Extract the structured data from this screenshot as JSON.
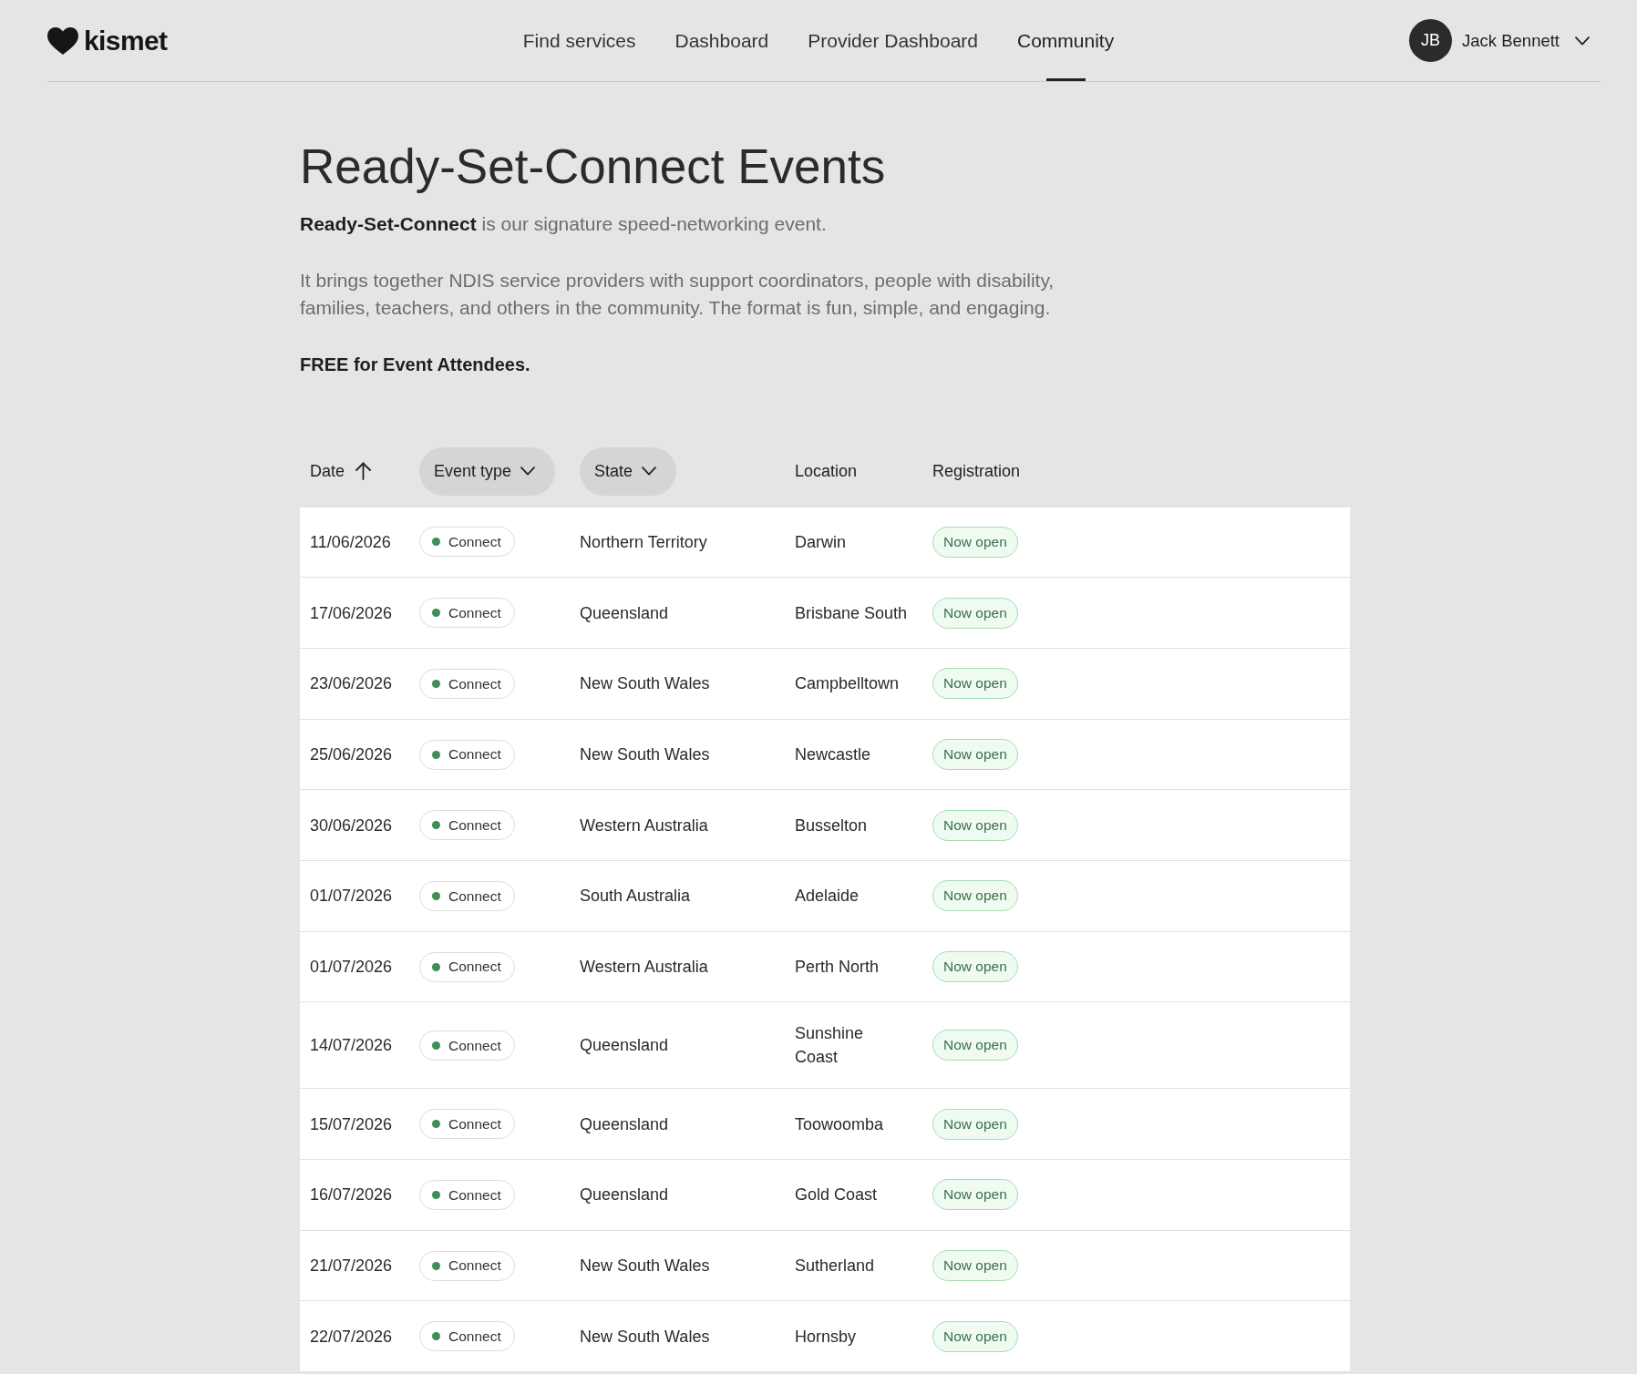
{
  "header": {
    "logo": "kismet",
    "nav": [
      {
        "label": "Find services",
        "selected": false
      },
      {
        "label": "Dashboard",
        "selected": false
      },
      {
        "label": "Provider Dashboard",
        "selected": false
      },
      {
        "label": "Community",
        "selected": true
      }
    ],
    "user": {
      "initials": "JB",
      "name": "Jack Bennett"
    }
  },
  "intro": {
    "title": "Ready-Set-Connect Events",
    "tagline": "**Ready-Set-Connect** is our signature speed-networking event.",
    "description": "It brings together NDIS service providers with support coordinators, people with disability, families, teachers, and others in the community. The format is fun, simple, and engaging.",
    "note": "FREE for Event Attendees."
  },
  "table": {
    "columns": [
      {
        "label": "Date",
        "kind": "sort",
        "ascending": true
      },
      {
        "label": "Event type",
        "kind": "filter"
      },
      {
        "label": "State",
        "kind": "filter"
      },
      {
        "label": "Location",
        "kind": "text"
      },
      {
        "label": "Registration",
        "kind": "text"
      }
    ],
    "rows": [
      {
        "date": "11/06/2026",
        "event_type": "Connect",
        "state": "Northern Territory",
        "location": "Darwin",
        "registration": "Now open"
      },
      {
        "date": "17/06/2026",
        "event_type": "Connect",
        "state": "Queensland",
        "location": "Brisbane South",
        "registration": "Now open"
      },
      {
        "date": "23/06/2026",
        "event_type": "Connect",
        "state": "New South Wales",
        "location": "Campbelltown",
        "registration": "Now open"
      },
      {
        "date": "25/06/2026",
        "event_type": "Connect",
        "state": "New South Wales",
        "location": "Newcastle",
        "registration": "Now open"
      },
      {
        "date": "30/06/2026",
        "event_type": "Connect",
        "state": "Western Australia",
        "location": "Busselton",
        "registration": "Now open"
      },
      {
        "date": "01/07/2026",
        "event_type": "Connect",
        "state": "South Australia",
        "location": "Adelaide",
        "registration": "Now open"
      },
      {
        "date": "01/07/2026",
        "event_type": "Connect",
        "state": "Western Australia",
        "location": "Perth North",
        "registration": "Now open"
      },
      {
        "date": "14/07/2026",
        "event_type": "Connect",
        "state": "Queensland",
        "location": "Sunshine Coast",
        "registration": "Now open"
      },
      {
        "date": "15/07/2026",
        "event_type": "Connect",
        "state": "Queensland",
        "location": "Toowoomba",
        "registration": "Now open"
      },
      {
        "date": "16/07/2026",
        "event_type": "Connect",
        "state": "Queensland",
        "location": "Gold Coast",
        "registration": "Now open"
      },
      {
        "date": "21/07/2026",
        "event_type": "Connect",
        "state": "New South Wales",
        "location": "Sutherland",
        "registration": "Now open"
      },
      {
        "date": "22/07/2026",
        "event_type": "Connect",
        "state": "New South Wales",
        "location": "Hornsby",
        "registration": "Now open"
      }
    ]
  }
}
